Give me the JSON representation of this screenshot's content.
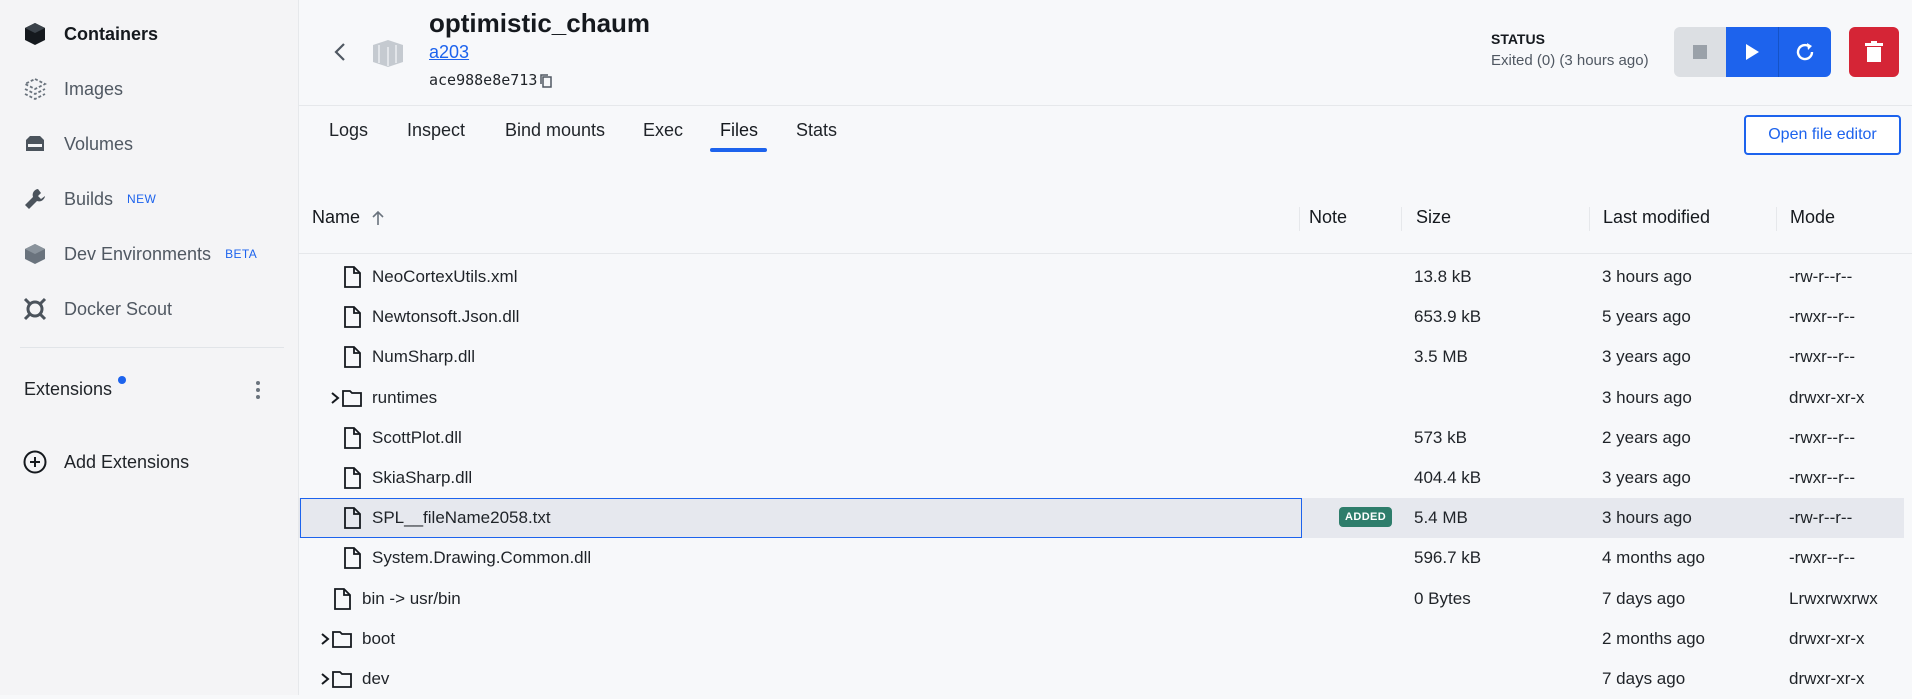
{
  "sidebar": {
    "items": [
      {
        "label": "Containers",
        "icon": "containers-icon",
        "active": true
      },
      {
        "label": "Images",
        "icon": "images-icon"
      },
      {
        "label": "Volumes",
        "icon": "volumes-icon"
      },
      {
        "label": "Builds",
        "icon": "builds-icon",
        "badge": "NEW"
      },
      {
        "label": "Dev Environments",
        "icon": "dev-environments-icon",
        "badge": "BETA"
      },
      {
        "label": "Docker Scout",
        "icon": "docker-scout-icon"
      }
    ],
    "extensions_label": "Extensions",
    "add_extensions_label": "Add Extensions"
  },
  "header": {
    "container_name": "optimistic_chaum",
    "image_link": "a203",
    "container_id": "ace988e8e713",
    "status_label": "STATUS",
    "status_value": "Exited (0) (3 hours ago)"
  },
  "tabs": [
    {
      "label": "Logs"
    },
    {
      "label": "Inspect"
    },
    {
      "label": "Bind mounts"
    },
    {
      "label": "Exec"
    },
    {
      "label": "Files",
      "active": true
    },
    {
      "label": "Stats"
    }
  ],
  "open_file_editor_label": "Open file editor",
  "table": {
    "columns": {
      "name": "Name",
      "note": "Note",
      "size": "Size",
      "modified": "Last modified",
      "mode": "Mode"
    },
    "rows": [
      {
        "name": "NeoCortexUtils.xml",
        "type": "file",
        "note": "",
        "size": "13.8 kB",
        "modified": "3 hours ago",
        "mode": "-rw-r--r--"
      },
      {
        "name": "Newtonsoft.Json.dll",
        "type": "file",
        "note": "",
        "size": "653.9 kB",
        "modified": "5 years ago",
        "mode": "-rwxr--r--"
      },
      {
        "name": "NumSharp.dll",
        "type": "file",
        "note": "",
        "size": "3.5 MB",
        "modified": "3 years ago",
        "mode": "-rwxr--r--"
      },
      {
        "name": "runtimes",
        "type": "folder",
        "note": "",
        "size": "",
        "modified": "3 hours ago",
        "mode": "drwxr-xr-x"
      },
      {
        "name": "ScottPlot.dll",
        "type": "file",
        "note": "",
        "size": "573 kB",
        "modified": "2 years ago",
        "mode": "-rwxr--r--"
      },
      {
        "name": "SkiaSharp.dll",
        "type": "file",
        "note": "",
        "size": "404.4 kB",
        "modified": "3 years ago",
        "mode": "-rwxr--r--"
      },
      {
        "name": "SPL__fileName2058.txt",
        "type": "file",
        "note": "ADDED",
        "size": "5.4 MB",
        "modified": "3 hours ago",
        "mode": "-rw-r--r--",
        "selected": true
      },
      {
        "name": "System.Drawing.Common.dll",
        "type": "file",
        "note": "",
        "size": "596.7 kB",
        "modified": "4 months ago",
        "mode": "-rwxr--r--"
      },
      {
        "name": "bin -> usr/bin",
        "type": "file",
        "note": "",
        "size": "0 Bytes",
        "modified": "7 days ago",
        "mode": "Lrwxrwxrwx"
      },
      {
        "name": "boot",
        "type": "folder",
        "note": "",
        "size": "",
        "modified": "2 months ago",
        "mode": "drwxr-xr-x"
      },
      {
        "name": "dev",
        "type": "folder",
        "note": "",
        "size": "",
        "modified": "7 days ago",
        "mode": "drwxr-xr-x"
      }
    ]
  },
  "colors": {
    "accent": "#1d63ed",
    "danger": "#d52536",
    "added_badge": "#2e7d6b"
  }
}
